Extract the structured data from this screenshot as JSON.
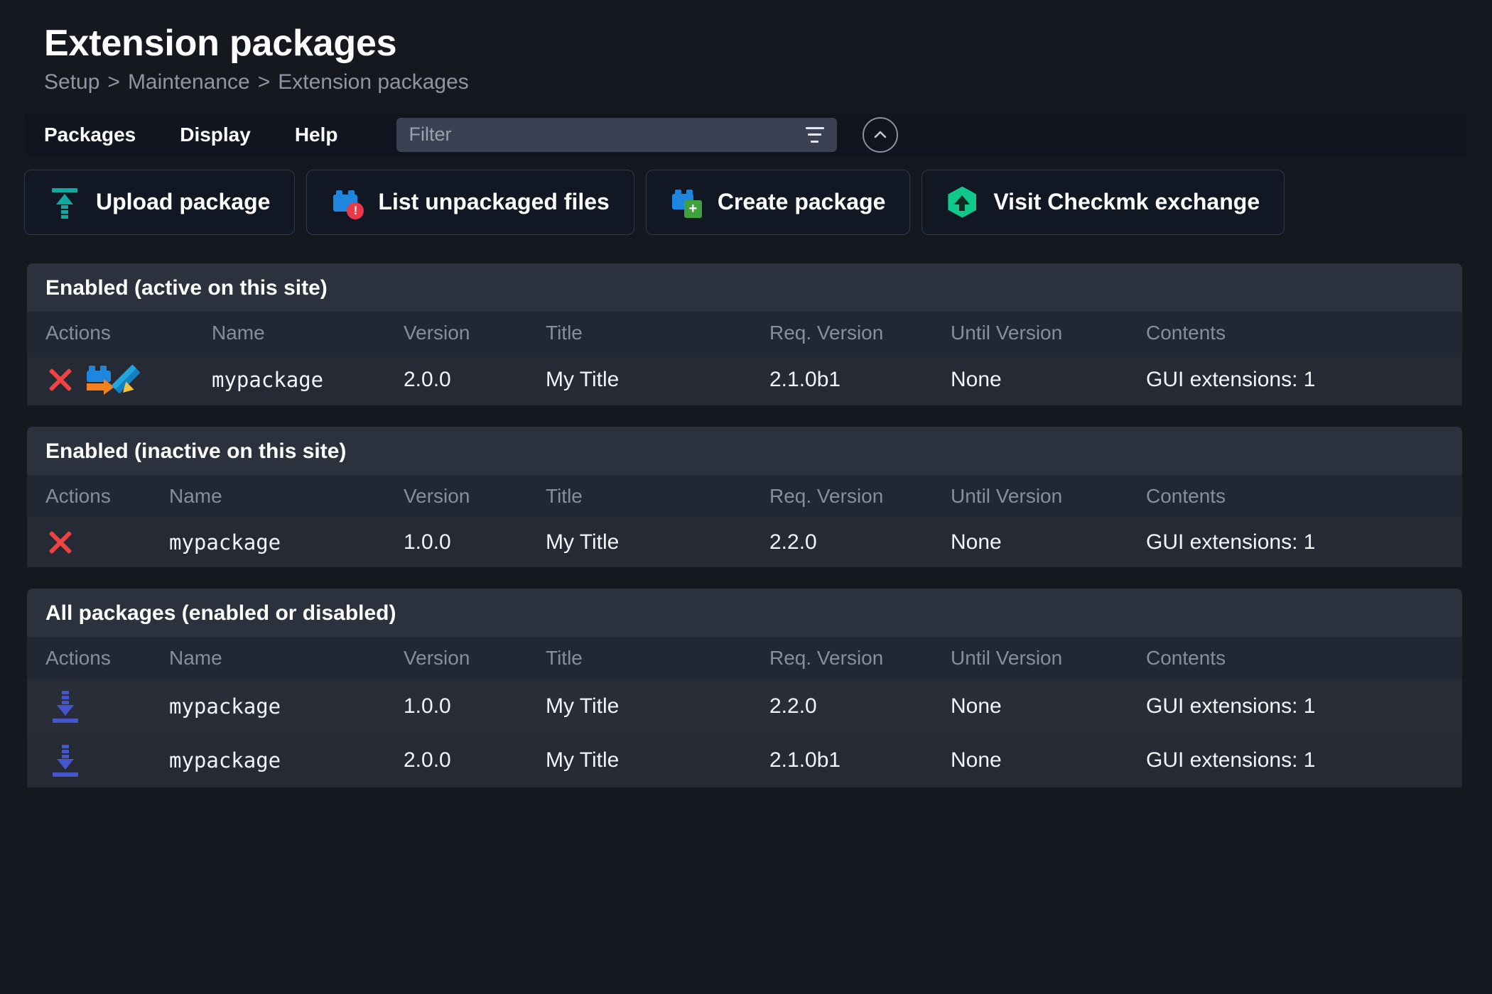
{
  "header": {
    "title": "Extension packages",
    "breadcrumb": [
      "Setup",
      "Maintenance",
      "Extension packages"
    ],
    "separator": ">"
  },
  "menubar": {
    "items": [
      {
        "label": "Packages",
        "name": "menu-packages"
      },
      {
        "label": "Display",
        "name": "menu-display"
      },
      {
        "label": "Help",
        "name": "menu-help"
      }
    ],
    "filter": {
      "placeholder": "Filter",
      "value": "",
      "icon": "filter-icon"
    },
    "collapse": {
      "icon": "chevron-up-icon"
    }
  },
  "actions": [
    {
      "label": "Upload package",
      "icon": "upload-icon"
    },
    {
      "label": "List unpackaged files",
      "icon": "package-warning-icon"
    },
    {
      "label": "Create package",
      "icon": "package-add-icon"
    },
    {
      "label": "Visit Checkmk exchange",
      "icon": "hexagon-up-arrow-icon"
    }
  ],
  "columns": [
    "Actions",
    "Name",
    "Version",
    "Title",
    "Req. Version",
    "Until Version",
    "Contents"
  ],
  "sections": [
    {
      "title": "Enabled (active on this site)",
      "rows": [
        {
          "actions": [
            "disable-icon",
            "package-export-icon",
            "edit-icon"
          ],
          "name": "mypackage",
          "version": "2.0.0",
          "title_text": "My Title",
          "req_version": "2.1.0b1",
          "until_version": "None",
          "contents": "GUI extensions: 1"
        }
      ]
    },
    {
      "title": "Enabled (inactive on this site)",
      "rows": [
        {
          "actions": [
            "disable-icon"
          ],
          "name": "mypackage",
          "version": "1.0.0",
          "title_text": "My Title",
          "req_version": "2.2.0",
          "until_version": "None",
          "contents": "GUI extensions: 1"
        }
      ]
    },
    {
      "title": "All packages (enabled or disabled)",
      "rows": [
        {
          "actions": [
            "download-icon"
          ],
          "name": "mypackage",
          "version": "1.0.0",
          "title_text": "My Title",
          "req_version": "2.2.0",
          "until_version": "None",
          "contents": "GUI extensions: 1"
        },
        {
          "actions": [
            "download-icon"
          ],
          "name": "mypackage",
          "version": "2.0.0",
          "title_text": "My Title",
          "req_version": "2.1.0b1",
          "until_version": "None",
          "contents": "GUI extensions: 1"
        }
      ]
    }
  ],
  "colors": {
    "page_bg": "#15191f",
    "section_header_bg": "#2b313d",
    "accent_teal": "#13a89e",
    "accent_green": "#10c88c",
    "accent_blue": "#1f86e0",
    "accent_orange": "#f08020",
    "accent_red": "#ef4343",
    "accent_indigo": "#4555cc"
  }
}
